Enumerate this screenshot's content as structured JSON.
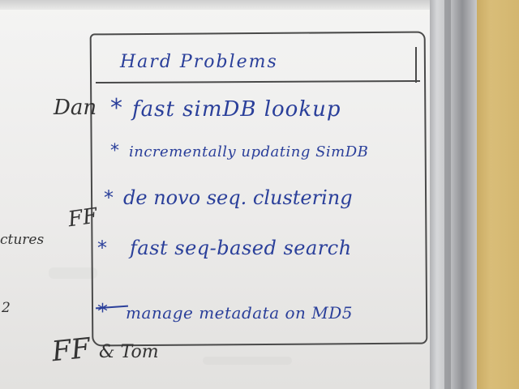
{
  "board": {
    "title": "Hard Problems",
    "items": [
      {
        "text": "fast simDB lookup"
      },
      {
        "text": "incrementally updating SimDB"
      },
      {
        "text": "de novo seq. clustering"
      },
      {
        "text": "fast seq-based search"
      },
      {
        "text": "manage metadata on MD5"
      }
    ],
    "bullet": "*",
    "margin_notes": {
      "name_1": "Dan",
      "name_2": "FF",
      "fragment_1": "ctures",
      "fragment_2": "2",
      "name_3": "FF",
      "name_4": "& Tom"
    }
  },
  "colors": {
    "marker_blue": "#2a3f9a",
    "marker_black": "#333333",
    "board": "#ecebea",
    "frame": "#bfc0c3",
    "wall": "#d3b66f"
  }
}
